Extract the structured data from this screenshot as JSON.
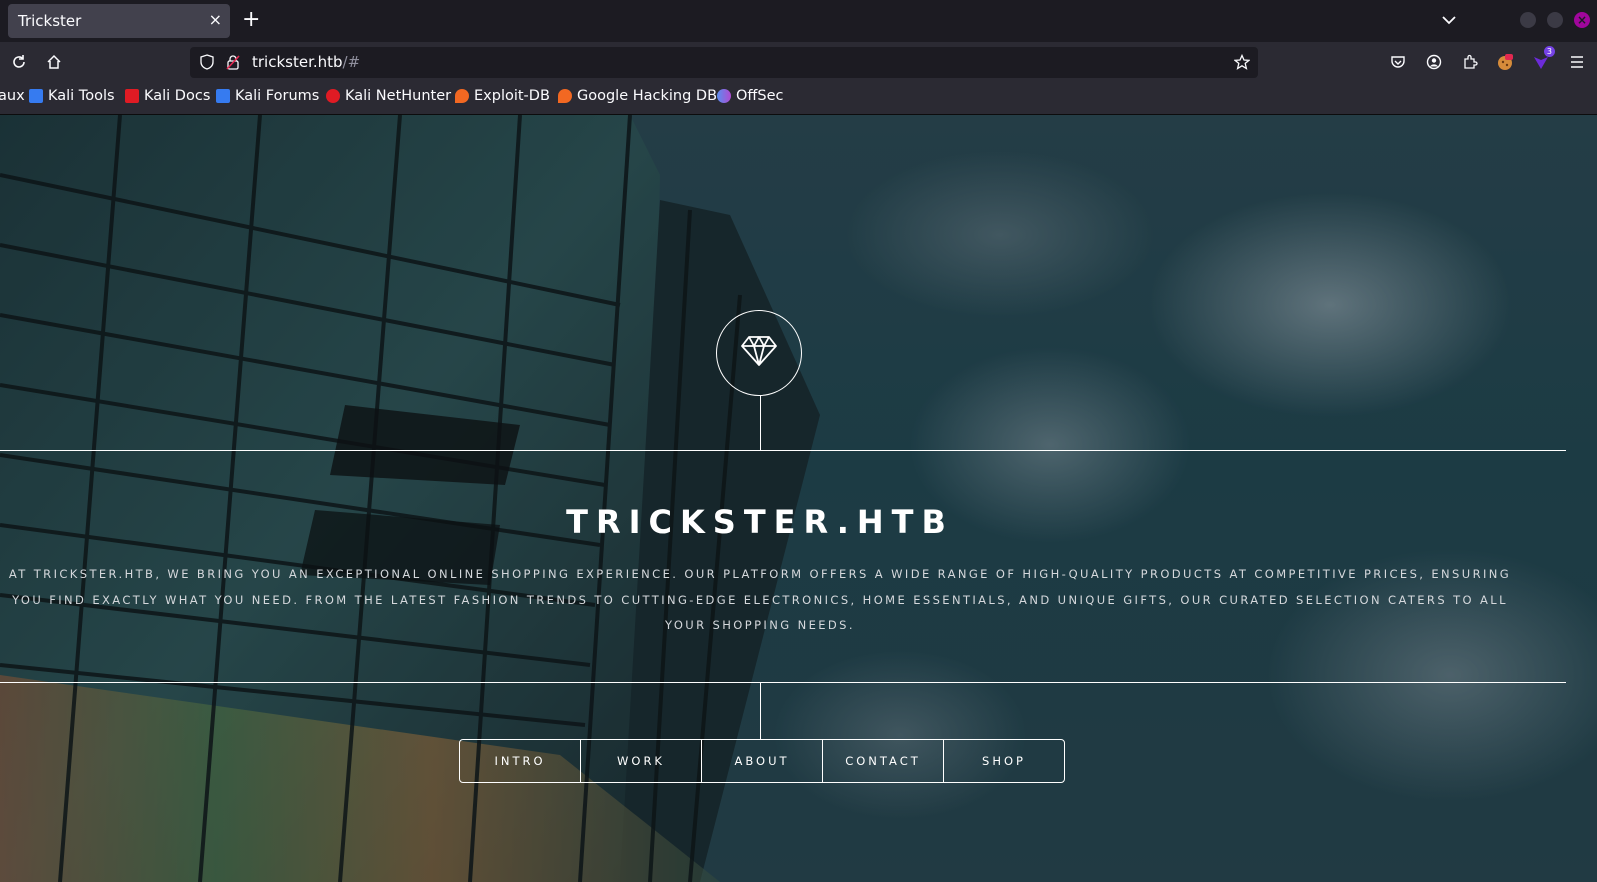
{
  "browser": {
    "tab": {
      "title": "Trickster",
      "close_icon": "×"
    },
    "new_tab_icon": "+",
    "url": {
      "host": "trickster.htb",
      "suffix": "/#"
    },
    "extension_badge": "3"
  },
  "bookmarks": [
    {
      "label": "aux",
      "icon": "kali-linux-icon",
      "color": "#2777ff"
    },
    {
      "label": "Kali Tools",
      "icon": "kali-tools-icon",
      "color": "#367bf0"
    },
    {
      "label": "Kali Docs",
      "icon": "kali-docs-icon",
      "color": "#e01b24"
    },
    {
      "label": "Kali Forums",
      "icon": "kali-forums-icon",
      "color": "#367bf0"
    },
    {
      "label": "Kali NetHunter",
      "icon": "kali-nethunter-icon",
      "color": "#e01b24"
    },
    {
      "label": "Exploit-DB",
      "icon": "exploit-db-icon",
      "color": "#f26822"
    },
    {
      "label": "Google Hacking DB",
      "icon": "ghdb-icon",
      "color": "#f26822"
    },
    {
      "label": "OffSec",
      "icon": "offsec-icon",
      "color": "#5b8def"
    }
  ],
  "site": {
    "title": "TRICKSTER.HTB",
    "description": "AT TRICKSTER.HTB, WE BRING YOU AN EXCEPTIONAL ONLINE SHOPPING EXPERIENCE. OUR PLATFORM OFFERS A WIDE RANGE OF HIGH-QUALITY PRODUCTS AT COMPETITIVE PRICES, ENSURING YOU FIND EXACTLY WHAT YOU NEED. FROM THE LATEST FASHION TRENDS TO CUTTING-EDGE ELECTRONICS, HOME ESSENTIALS, AND UNIQUE GIFTS, OUR CURATED SELECTION CATERS TO ALL YOUR SHOPPING NEEDS.",
    "logo_icon": "diamond-icon",
    "menu": [
      "INTRO",
      "WORK",
      "ABOUT",
      "CONTACT",
      "SHOP"
    ]
  },
  "colors": {
    "browser_bg": "#1c1b22",
    "toolbar_bg": "#2b2a33",
    "tab_active": "#42414d",
    "window_close": "#a0069c"
  }
}
